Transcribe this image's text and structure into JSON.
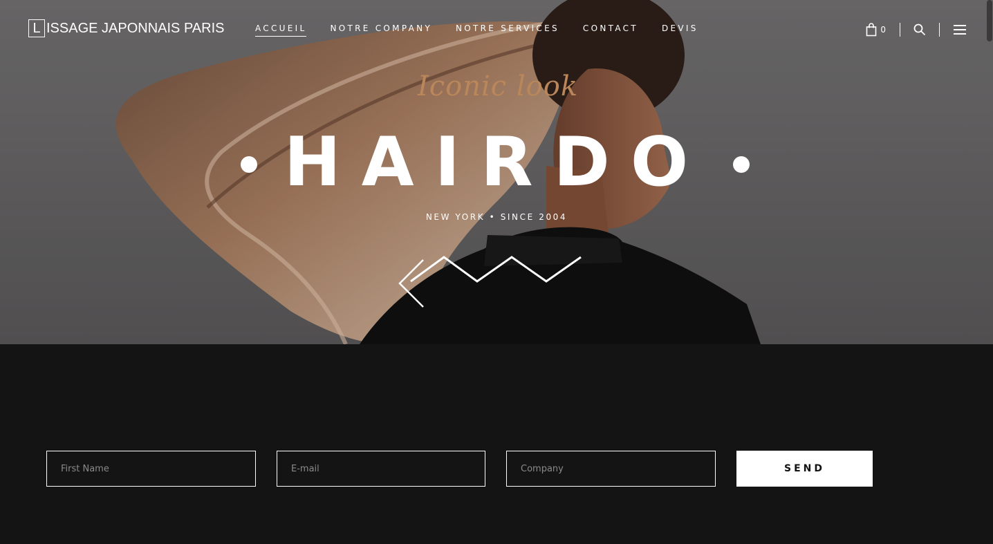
{
  "header": {
    "logo_letter": "L",
    "logo_rest": "ISSAGE JAPONNAIS PARIS",
    "nav": [
      {
        "label": "ACCUEIL",
        "active": true
      },
      {
        "label": "NOTRE COMPANY",
        "active": false
      },
      {
        "label": "NOTRE SERVICES",
        "active": false
      },
      {
        "label": "CONTACT",
        "active": false
      },
      {
        "label": "DEVIS",
        "active": false
      }
    ],
    "cart_count": "0",
    "icons": {
      "cart": "shopping-bag-icon",
      "search": "search-icon",
      "menu": "hamburger-menu-icon"
    }
  },
  "hero": {
    "script_subtitle": "Iconic look",
    "title": "HAIRDO",
    "tagline": "NEW YORK • SINCE 2004",
    "accent_color": "#b9875a"
  },
  "form": {
    "first_name_placeholder": "First Name",
    "email_placeholder": "E-mail",
    "company_placeholder": "Company",
    "send_label": "SEND"
  }
}
